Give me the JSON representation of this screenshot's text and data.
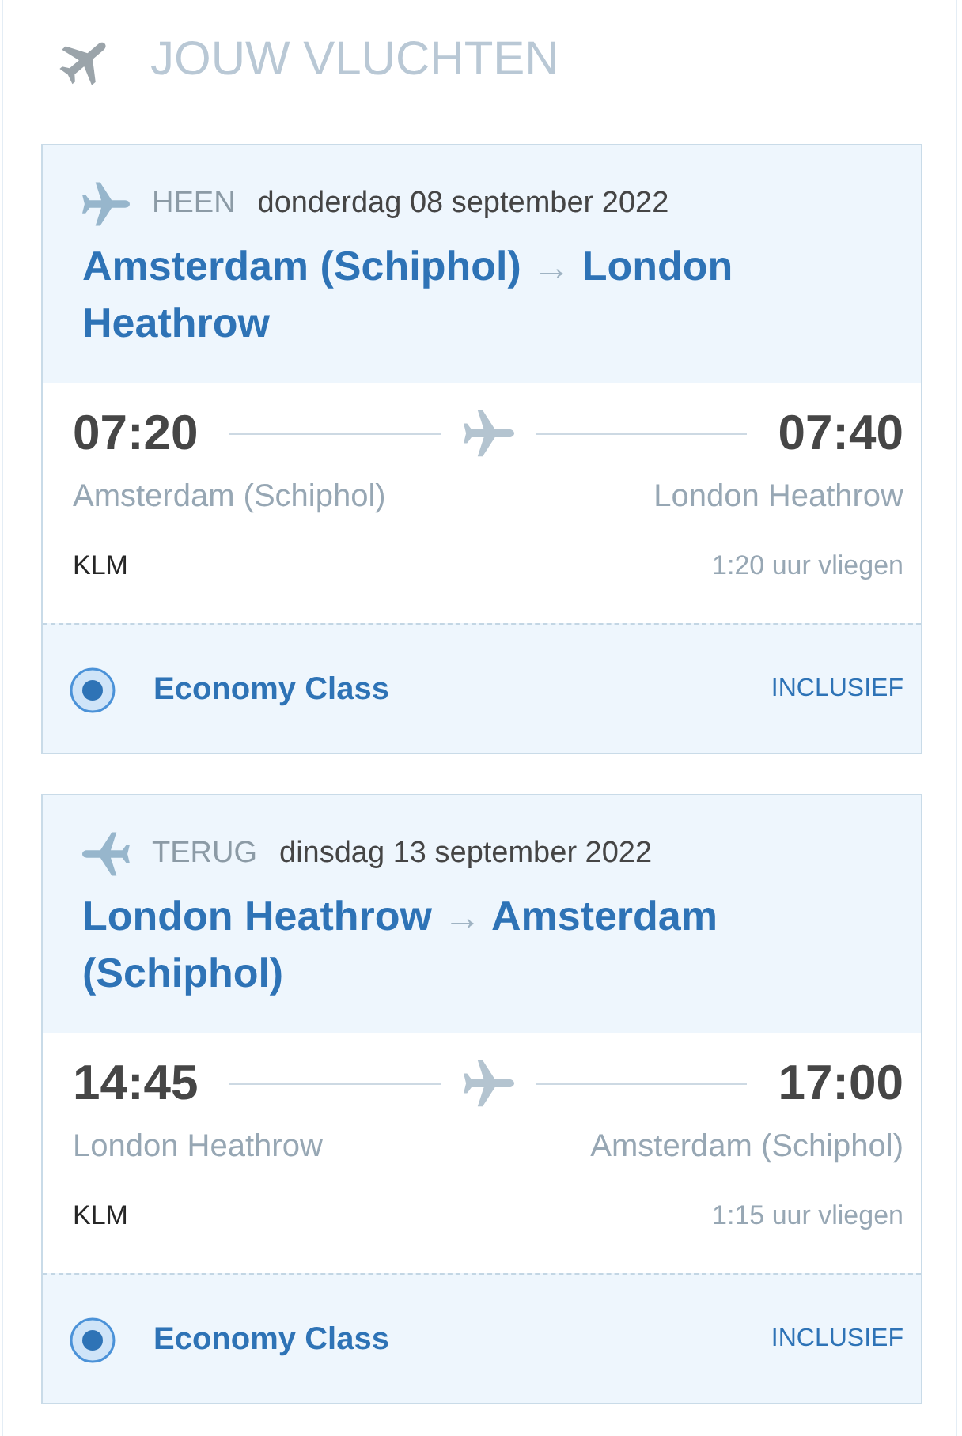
{
  "title": "JOUW VLUCHTEN",
  "flights": [
    {
      "kind": "outbound",
      "label": "HEEN",
      "date": "donderdag 08 september 2022",
      "origin": "Amsterdam (Schiphol)",
      "route_arrow": "→",
      "destination": "London Heathrow",
      "departure_time": "07:20",
      "arrival_time": "07:40",
      "departure_airport": "Amsterdam (Schiphol)",
      "arrival_airport": "London Heathrow",
      "airline": "KLM",
      "duration": "1:20 uur vliegen",
      "fare": {
        "name": "Economy Class",
        "selected": true,
        "price": "INCLUSIEF"
      }
    },
    {
      "kind": "return",
      "label": "TERUG",
      "date": "dinsdag 13 september 2022",
      "origin": "London Heathrow",
      "route_arrow": "→",
      "destination": "Amsterdam (Schiphol)",
      "departure_time": "14:45",
      "arrival_time": "17:00",
      "departure_airport": "London Heathrow",
      "arrival_airport": "Amsterdam (Schiphol)",
      "airline": "KLM",
      "duration": "1:15 uur vliegen",
      "fare": {
        "name": "Economy Class",
        "selected": true,
        "price": "INCLUSIEF"
      }
    }
  ]
}
